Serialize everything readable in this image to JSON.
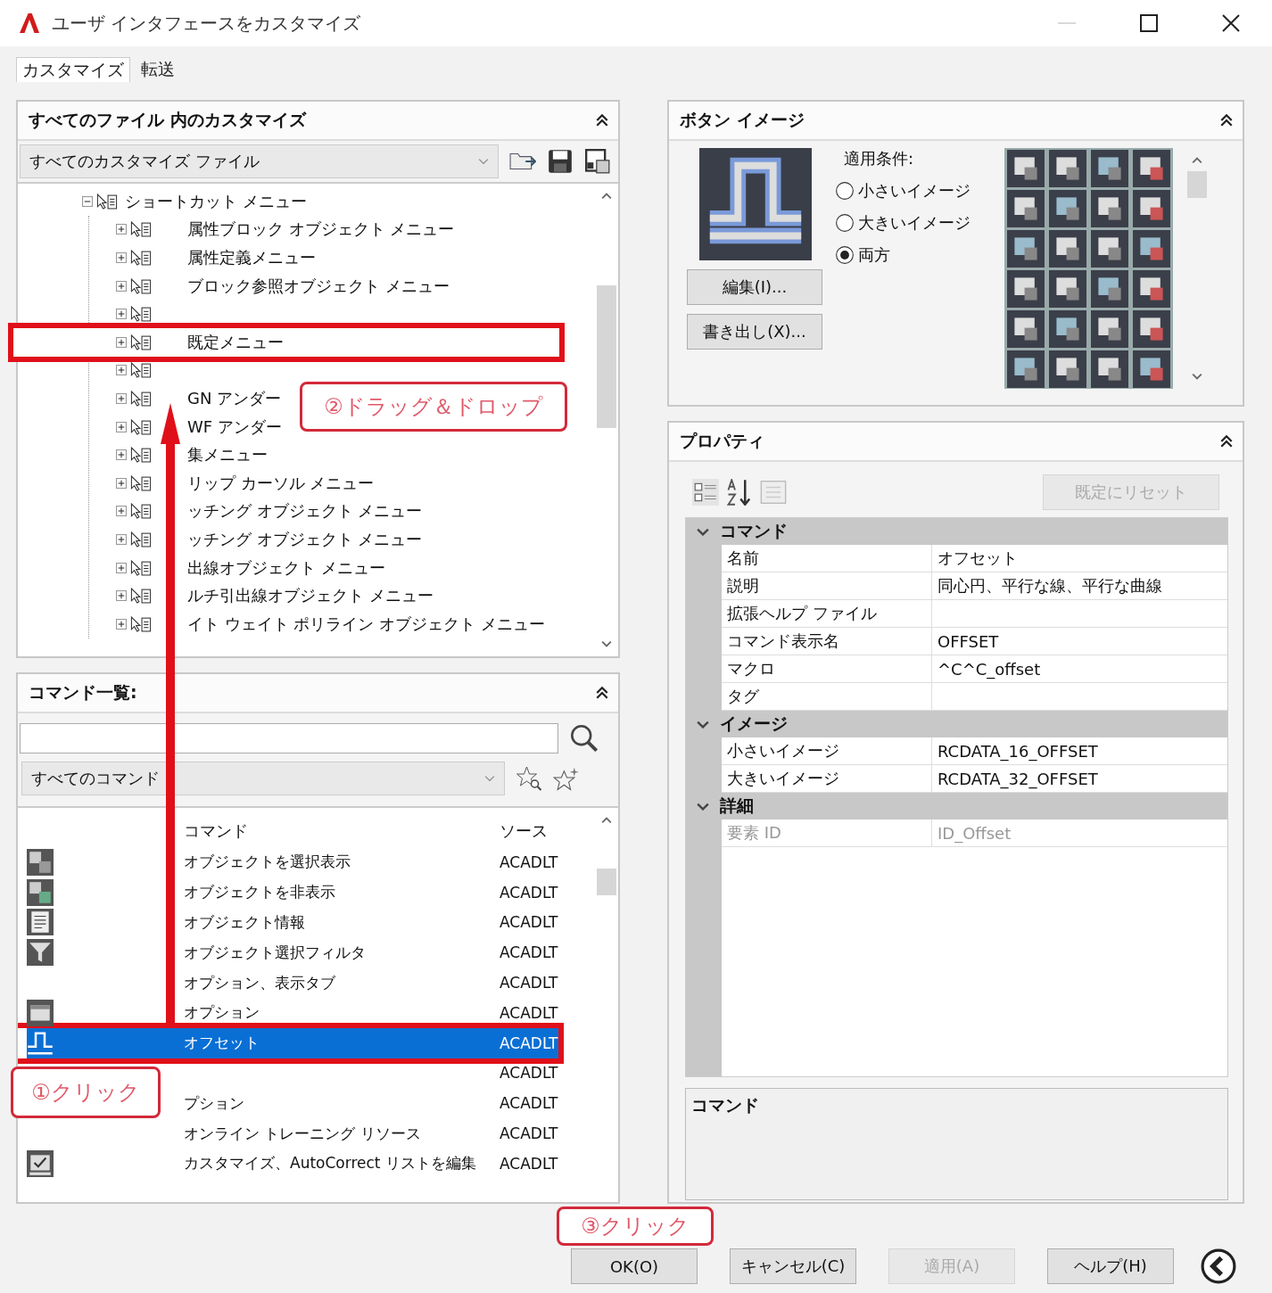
{
  "window": {
    "title": "ユーザ インタフェースをカスタマイズ"
  },
  "tabs": [
    {
      "label": "カスタマイズ",
      "selected": true
    },
    {
      "label": "転送",
      "selected": false
    }
  ],
  "files_panel": {
    "title": "すべてのファイル 内のカスタマイズ",
    "dropdown": "すべてのカスタマイズ ファイル",
    "tree": [
      {
        "label": "ショートカット メニュー",
        "expanded": true,
        "children": [
          {
            "label": "属性ブロック オブジェクト メニュー",
            "expanded": false,
            "highlighted": false
          },
          {
            "label": "属性定義メニュー",
            "expanded": false,
            "highlighted": false
          },
          {
            "label": "ブロック参照オブジェクト メニュー",
            "expanded": false,
            "highlighted": false
          },
          {
            "expanded": false,
            "highlighted": false
          },
          {
            "label": "既定メニュー",
            "expanded": false,
            "highlighted": true
          },
          {
            "expanded": false,
            "highlighted": false
          },
          {
            "label": "GN アンダー",
            "expanded": false,
            "highlighted": false
          },
          {
            "label": "WF アンダー",
            "expanded": false,
            "highlighted": false
          },
          {
            "label": "集メニュー",
            "expanded": false,
            "highlighted": false
          },
          {
            "label": "リップ カーソル メニュー",
            "expanded": false,
            "highlighted": false
          },
          {
            "label": "ッチング オブジェクト メニュー",
            "expanded": false,
            "highlighted": false
          },
          {
            "label": "ッチング オブジェクト メニュー",
            "expanded": false,
            "highlighted": false
          },
          {
            "label": "出線オブジェクト メニュー",
            "expanded": false,
            "highlighted": false
          },
          {
            "label": "ルチ引出線オブジェクト メニュー",
            "expanded": false,
            "highlighted": false
          },
          {
            "label": "イト ウェイト ポリライン オブジェクト メニュー",
            "expanded": false,
            "highlighted": false
          }
        ]
      }
    ]
  },
  "commands_panel": {
    "title": "コマンド一覧:",
    "filter": "すべてのコマンド",
    "columns": [
      "コマンド",
      "ソース"
    ],
    "rows": [
      {
        "kind": "select",
        "command": "オブジェクトを選択表示",
        "source": "ACADLT",
        "selected": false
      },
      {
        "kind": "hide",
        "command": "オブジェクトを非表示",
        "source": "ACADLT",
        "selected": false
      },
      {
        "kind": "info",
        "command": "オブジェクト情報",
        "source": "ACADLT",
        "selected": false
      },
      {
        "kind": "filter",
        "command": "オブジェクト選択フィルタ",
        "source": "ACADLT",
        "selected": false
      },
      {
        "kind": "plain",
        "command": "オプション、表示タブ",
        "source": "ACADLT",
        "selected": false
      },
      {
        "kind": "options",
        "command": "オプション",
        "source": "ACADLT",
        "selected": false
      },
      {
        "kind": "offset",
        "command": "オフセット",
        "source": "ACADLT",
        "selected": true
      },
      {
        "kind": "plain",
        "source": "ACADLT",
        "selected": false
      },
      {
        "kind": "plain",
        "command": "プション",
        "source": "ACADLT",
        "selected": false
      },
      {
        "kind": "plain",
        "command": "オンライン トレーニング リソース",
        "source": "ACADLT",
        "selected": false
      },
      {
        "kind": "edit",
        "command": "カスタマイズ、AutoCorrect リストを編集",
        "source": "ACADLT",
        "selected": false
      }
    ]
  },
  "button_image": {
    "title": "ボタン イメージ",
    "apply_label": "適用条件:",
    "options": [
      {
        "label": "小さいイメージ",
        "selected": false
      },
      {
        "label": "大きいイメージ",
        "selected": false
      },
      {
        "label": "両方",
        "selected": true
      }
    ],
    "buttons": [
      "編集(I)...",
      "書き出し(X)..."
    ]
  },
  "properties": {
    "title": "プロパティ",
    "reset_button": {
      "label": "既定にリセット",
      "disabled": true
    },
    "categories": [
      {
        "name": "コマンド",
        "rows": [
          {
            "name": "名前",
            "value": "オフセット",
            "disabled": false
          },
          {
            "name": "説明",
            "value": "同心円、平行な線、平行な曲線",
            "disabled": false
          },
          {
            "name": "拡張ヘルプ ファイル",
            "disabled": false
          },
          {
            "name": "コマンド表示名",
            "value": "OFFSET",
            "disabled": false
          },
          {
            "name": "マクロ",
            "value": "^C^C_offset",
            "disabled": false
          },
          {
            "name": "タグ",
            "disabled": false
          }
        ]
      },
      {
        "name": "イメージ",
        "rows": [
          {
            "name": "小さいイメージ",
            "value": "RCDATA_16_OFFSET",
            "disabled": false
          },
          {
            "name": "大きいイメージ",
            "value": "RCDATA_32_OFFSET",
            "disabled": false
          }
        ]
      },
      {
        "name": "詳細",
        "rows": [
          {
            "name": "要素 ID",
            "value": "ID_Offset",
            "disabled": true
          }
        ]
      }
    ],
    "description_title": "コマンド"
  },
  "footer_buttons": [
    {
      "label": "OK(O)",
      "disabled": false
    },
    {
      "label": "キャンセル(C)",
      "disabled": false
    },
    {
      "label": "適用(A)",
      "disabled": true
    },
    {
      "label": "ヘルプ(H)",
      "disabled": false
    }
  ],
  "annotations": [
    {
      "label": "②ドラッグ＆ドロップ"
    },
    {
      "label": "①クリック"
    },
    {
      "label": "③クリック"
    }
  ]
}
